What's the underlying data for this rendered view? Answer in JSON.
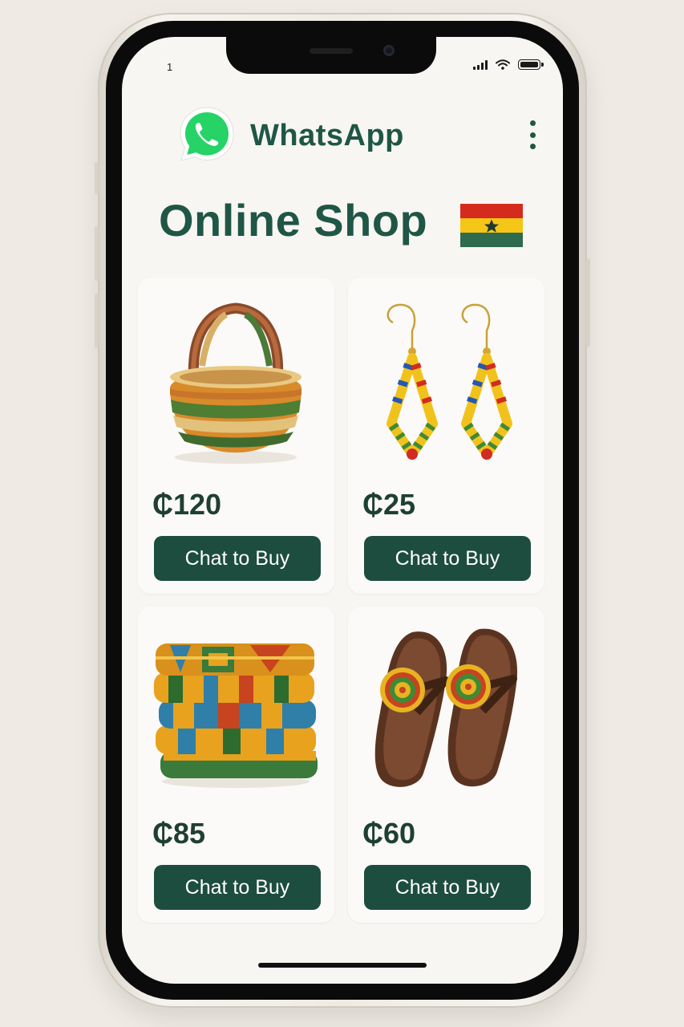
{
  "status_bar": {
    "time": "1"
  },
  "app": {
    "name": "WhatsApp",
    "logo_icon": "whatsapp-logo-icon",
    "menu_icon": "more-vert-icon",
    "brand_color": "#25D366"
  },
  "shop": {
    "title": "Online Shop",
    "flag_icon": "ghana-flag-icon",
    "flag_colors": [
      "#CE1126",
      "#FCD116",
      "#006B3F"
    ]
  },
  "theme": {
    "primary": "#1D4D3F",
    "button_text": "#FFFFFF",
    "background": "#F8F6F2"
  },
  "products": [
    {
      "image_icon": "woven-basket-icon",
      "price": "₵120",
      "button_label": "Chat to Buy"
    },
    {
      "image_icon": "beaded-earrings-icon",
      "price": "₵25",
      "button_label": "Chat to Buy"
    },
    {
      "image_icon": "kente-cloth-icon",
      "price": "₵85",
      "button_label": "Chat to Buy"
    },
    {
      "image_icon": "beaded-sandals-icon",
      "price": "₵60",
      "button_label": "Chat to Buy"
    }
  ]
}
